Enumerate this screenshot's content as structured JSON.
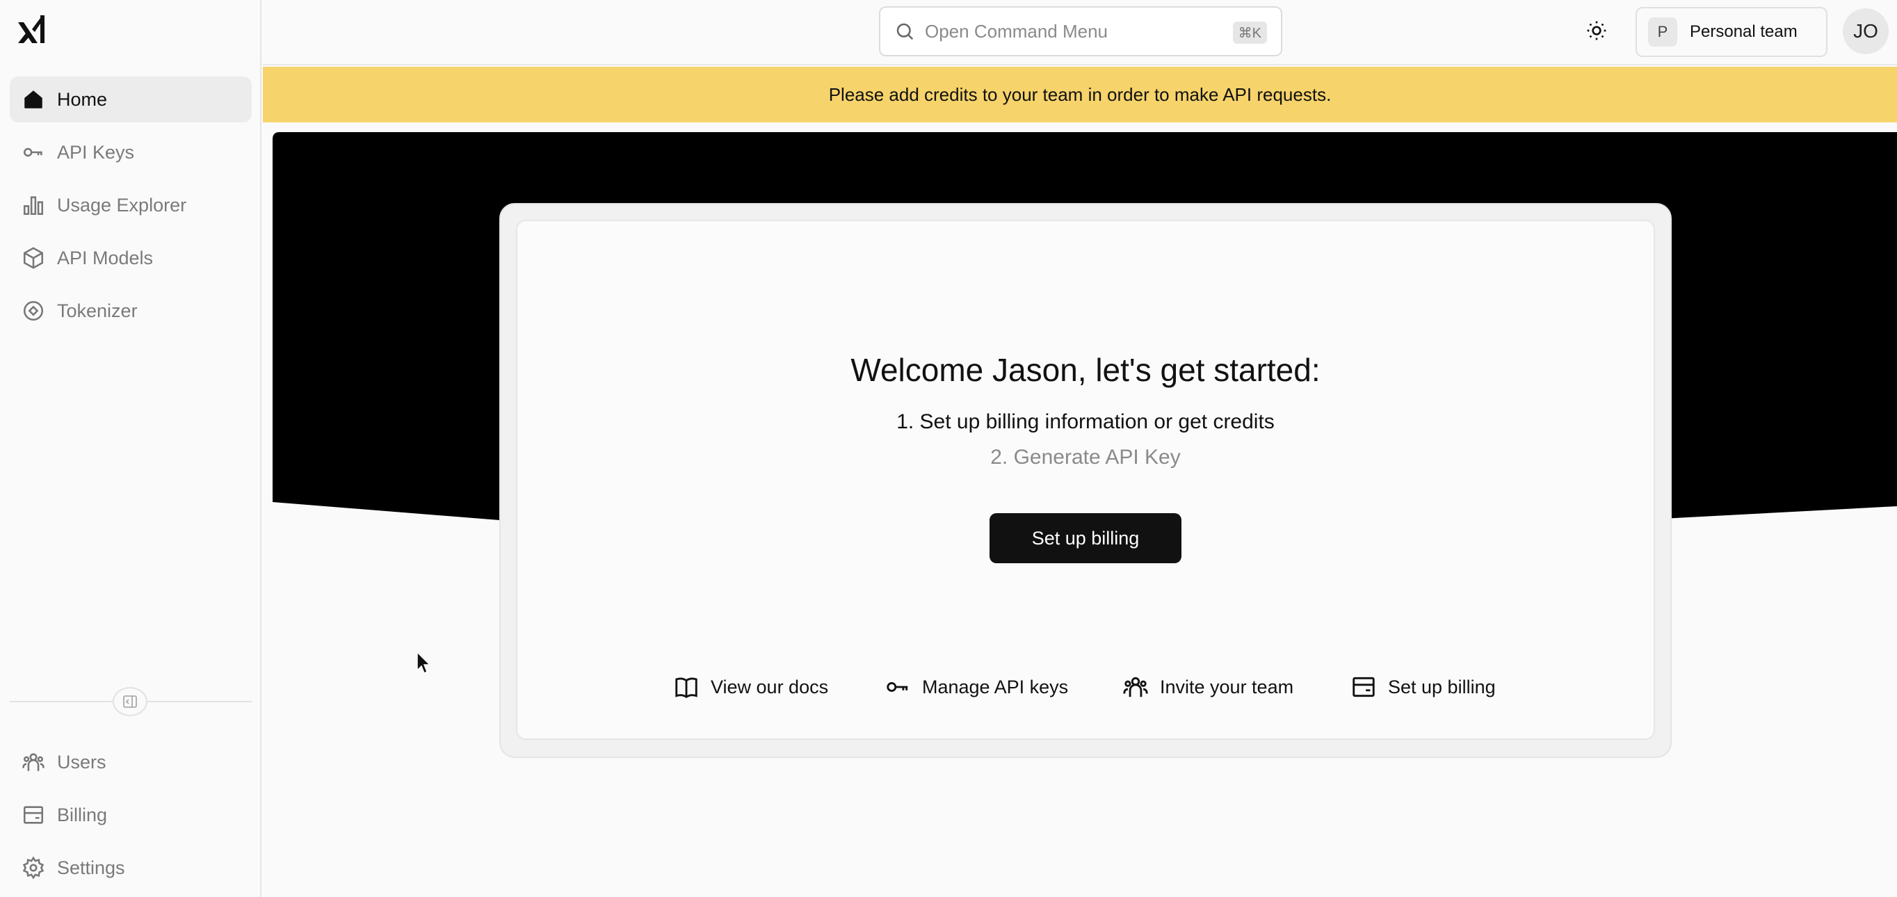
{
  "sidebar": {
    "items": [
      {
        "label": "Home",
        "icon": "home-icon"
      },
      {
        "label": "API Keys",
        "icon": "key-icon"
      },
      {
        "label": "Usage Explorer",
        "icon": "bar-chart-icon"
      },
      {
        "label": "API Models",
        "icon": "cube-icon"
      },
      {
        "label": "Tokenizer",
        "icon": "tokenizer-icon"
      }
    ],
    "bottom_items": [
      {
        "label": "Users",
        "icon": "users-icon"
      },
      {
        "label": "Billing",
        "icon": "billing-icon"
      },
      {
        "label": "Settings",
        "icon": "settings-icon"
      }
    ]
  },
  "topbar": {
    "command_placeholder": "Open Command Menu",
    "command_shortcut": "⌘K",
    "team_initial": "P",
    "team_name": "Personal team",
    "avatar_initials": "JO"
  },
  "banner": {
    "text": "Please add credits to your team in order to make API requests."
  },
  "welcome": {
    "title": "Welcome Jason, let's get started:",
    "step1": "1. Set up billing information or get credits",
    "step2": "2. Generate API Key",
    "cta_label": "Set up billing"
  },
  "quick_links": [
    {
      "label": "View our docs",
      "icon": "book-icon"
    },
    {
      "label": "Manage API keys",
      "icon": "key-icon"
    },
    {
      "label": "Invite your team",
      "icon": "users-icon"
    },
    {
      "label": "Set up billing",
      "icon": "billing-icon"
    }
  ],
  "colors": {
    "banner": "#f6d36b",
    "hero": "#000000",
    "primary_button": "#111111"
  }
}
